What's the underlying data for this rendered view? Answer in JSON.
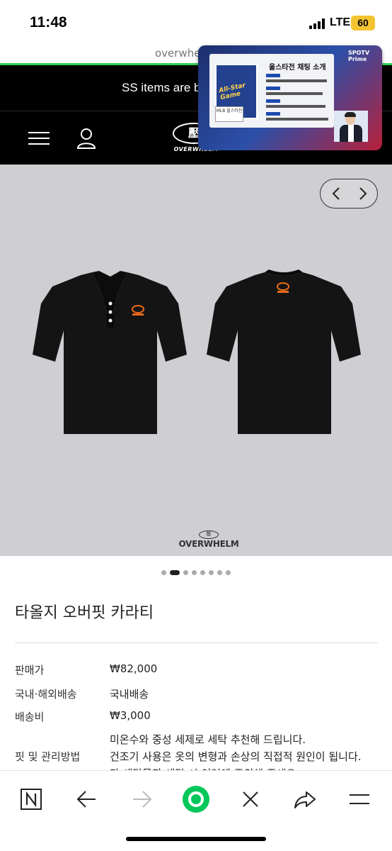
{
  "status_bar": {
    "time": "11:48",
    "network": "LTE",
    "battery": "60"
  },
  "browser": {
    "url": "overwhel",
    "url_title": "overwhelm"
  },
  "notice": {
    "text": "SS items are b"
  },
  "header": {
    "logo_emblem": "壓",
    "logo_text": "OVERWHELM"
  },
  "pip": {
    "panel_title": "올스타전 채팅 소개",
    "card_text": "All-Star Game",
    "mlb_label": "MLB 올스타전",
    "brand": "SPOTV Prime"
  },
  "product_image": {
    "brand_emblem": "壓",
    "brand_word": "OVERWHELM"
  },
  "pagination": {
    "count": 8,
    "active_index": 1
  },
  "product": {
    "title": "타올지 오버핏 카라티",
    "rows": [
      {
        "label": "판매가",
        "value": "₩82,000"
      },
      {
        "label": "국내·해외배송",
        "value": "국내배송"
      },
      {
        "label": "배송비",
        "value": "₩3,000"
      }
    ],
    "care_label": "핏 및 관리방법",
    "care_lines": [
      "미온수와 중성 세제로 세탁 추천해 드립니다.",
      "건조기 사용은 옷의 변형과 손상의 직접적 원인이 됩니다.",
      "타 세탁물과 세탁 시 이염에 주의해 주세요."
    ]
  },
  "colors": {
    "accent": "#2fcd56",
    "header_bg": "#000000",
    "image_bg": "#cfcfd3",
    "battery": "#f4c430"
  },
  "icons": [
    "menu-icon",
    "user-icon",
    "chevron-left-icon",
    "chevron-right-icon",
    "naver-n-icon",
    "back-arrow-icon",
    "forward-arrow-icon",
    "green-home-icon",
    "close-icon",
    "share-icon",
    "hamburger-icon"
  ]
}
